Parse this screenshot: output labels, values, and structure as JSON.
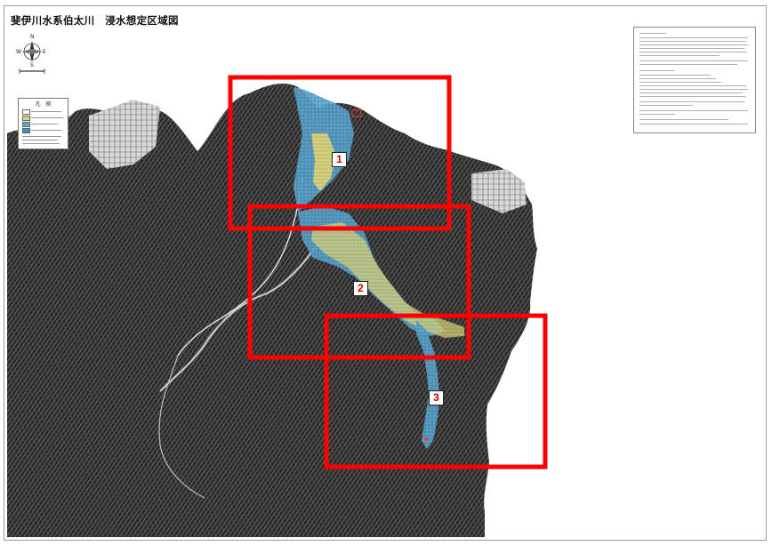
{
  "title": "斐伊川水系伯太川　浸水想定区域図",
  "legend": {
    "title": "凡　例"
  },
  "compass": {
    "n": "N",
    "s": "S",
    "e": "E",
    "w": "W"
  },
  "colors": {
    "frame_border": "#9a9a9a",
    "highlight_border": "#ff0000",
    "flood_blue": "#5fa8cf",
    "flood_yellow": "#d9d27a",
    "terrain_dark": "#1c1c1c",
    "terrain_light": "#9b9b9b",
    "label_text": "#cc0000"
  },
  "map_areas": [
    {
      "label": "1"
    },
    {
      "label": "2"
    },
    {
      "label": "3"
    }
  ]
}
